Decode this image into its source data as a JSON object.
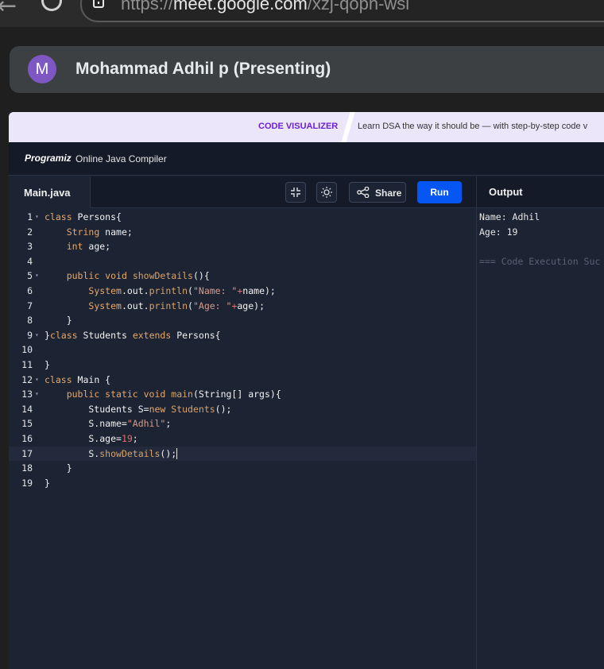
{
  "browser": {
    "url_scheme": "https://",
    "url_host": "meet.google.com",
    "url_path": "/xzj-qopn-wsi"
  },
  "meet": {
    "avatar_letter": "M",
    "presenter_label": "Mohammad Adhil p (Presenting)"
  },
  "promo": {
    "title": "CODE VISUALIZER",
    "text": "Learn DSA the way it should be — with step-by-step code v"
  },
  "nav": {
    "logo": "Programiz",
    "title": "Online Java Compiler"
  },
  "editor": {
    "tab_label": "Main.java",
    "share_label": "Share",
    "run_label": "Run",
    "active_line": 17,
    "lines": [
      {
        "n": "1",
        "fold": true,
        "tokens": [
          {
            "t": "kw",
            "v": "class"
          },
          {
            "t": "pl",
            "v": " Persons{"
          }
        ]
      },
      {
        "n": "2",
        "fold": false,
        "tokens": [
          {
            "t": "pl",
            "v": "    "
          },
          {
            "t": "kw",
            "v": "String"
          },
          {
            "t": "pl",
            "v": " name;"
          }
        ]
      },
      {
        "n": "3",
        "fold": false,
        "tokens": [
          {
            "t": "pl",
            "v": "    "
          },
          {
            "t": "kw",
            "v": "int"
          },
          {
            "t": "pl",
            "v": " age;"
          }
        ]
      },
      {
        "n": "4",
        "fold": false,
        "tokens": [
          {
            "t": "pl",
            "v": ""
          }
        ]
      },
      {
        "n": "5",
        "fold": true,
        "tokens": [
          {
            "t": "pl",
            "v": "    "
          },
          {
            "t": "kw",
            "v": "public void"
          },
          {
            "t": "pl",
            "v": " "
          },
          {
            "t": "fn",
            "v": "showDetails"
          },
          {
            "t": "pl",
            "v": "(){"
          }
        ]
      },
      {
        "n": "6",
        "fold": false,
        "tokens": [
          {
            "t": "pl",
            "v": "        "
          },
          {
            "t": "kw",
            "v": "System"
          },
          {
            "t": "pl",
            "v": ".out."
          },
          {
            "t": "fn",
            "v": "println"
          },
          {
            "t": "pl",
            "v": "("
          },
          {
            "t": "str",
            "v": "\"Name: \""
          },
          {
            "t": "num",
            "v": "+"
          },
          {
            "t": "pl",
            "v": "name);"
          }
        ]
      },
      {
        "n": "7",
        "fold": false,
        "tokens": [
          {
            "t": "pl",
            "v": "        "
          },
          {
            "t": "kw",
            "v": "System"
          },
          {
            "t": "pl",
            "v": ".out."
          },
          {
            "t": "fn",
            "v": "println"
          },
          {
            "t": "pl",
            "v": "("
          },
          {
            "t": "str",
            "v": "\"Age: \""
          },
          {
            "t": "num",
            "v": "+"
          },
          {
            "t": "pl",
            "v": "age);"
          }
        ]
      },
      {
        "n": "8",
        "fold": false,
        "tokens": [
          {
            "t": "pl",
            "v": "    }"
          }
        ]
      },
      {
        "n": "9",
        "fold": true,
        "tokens": [
          {
            "t": "pl",
            "v": "}"
          },
          {
            "t": "kw",
            "v": "class"
          },
          {
            "t": "pl",
            "v": " Students "
          },
          {
            "t": "kw",
            "v": "extends"
          },
          {
            "t": "pl",
            "v": " Persons{"
          }
        ]
      },
      {
        "n": "10",
        "fold": false,
        "tokens": [
          {
            "t": "pl",
            "v": ""
          }
        ]
      },
      {
        "n": "11",
        "fold": false,
        "tokens": [
          {
            "t": "pl",
            "v": "}"
          }
        ]
      },
      {
        "n": "12",
        "fold": true,
        "tokens": [
          {
            "t": "kw",
            "v": "class"
          },
          {
            "t": "pl",
            "v": " Main {"
          }
        ]
      },
      {
        "n": "13",
        "fold": true,
        "tokens": [
          {
            "t": "pl",
            "v": "    "
          },
          {
            "t": "kw",
            "v": "public static void"
          },
          {
            "t": "pl",
            "v": " "
          },
          {
            "t": "fn",
            "v": "main"
          },
          {
            "t": "pl",
            "v": "(String[] args){"
          }
        ]
      },
      {
        "n": "14",
        "fold": false,
        "tokens": [
          {
            "t": "pl",
            "v": "        Students S="
          },
          {
            "t": "kw",
            "v": "new"
          },
          {
            "t": "pl",
            "v": " "
          },
          {
            "t": "fn",
            "v": "Students"
          },
          {
            "t": "pl",
            "v": "();"
          }
        ]
      },
      {
        "n": "15",
        "fold": false,
        "tokens": [
          {
            "t": "pl",
            "v": "        S.name="
          },
          {
            "t": "str",
            "v": "\"Adhil\""
          },
          {
            "t": "pl",
            "v": ";"
          }
        ]
      },
      {
        "n": "16",
        "fold": false,
        "tokens": [
          {
            "t": "pl",
            "v": "        S.age="
          },
          {
            "t": "num",
            "v": "19"
          },
          {
            "t": "pl",
            "v": ";"
          }
        ]
      },
      {
        "n": "17",
        "fold": false,
        "tokens": [
          {
            "t": "pl",
            "v": "        S."
          },
          {
            "t": "fn",
            "v": "showDetails"
          },
          {
            "t": "pl",
            "v": "();"
          }
        ]
      },
      {
        "n": "18",
        "fold": false,
        "tokens": [
          {
            "t": "pl",
            "v": "    }"
          }
        ]
      },
      {
        "n": "19",
        "fold": false,
        "tokens": [
          {
            "t": "pl",
            "v": "}"
          }
        ]
      }
    ]
  },
  "output": {
    "title": "Output",
    "lines": [
      {
        "text": "Name: Adhil",
        "muted": false
      },
      {
        "text": "Age: 19",
        "muted": false
      },
      {
        "text": "",
        "muted": false
      },
      {
        "text": "=== Code Execution Suc",
        "muted": true
      }
    ]
  },
  "colors": {
    "run_button": "#0556f3",
    "promo_accent": "#6b21d8",
    "avatar": "#7e57c2",
    "editor_bg": "#1c2333"
  },
  "icons": {
    "exit_fullscreen": "collapse-icon",
    "theme": "sun-icon",
    "share": "share-nodes-icon"
  }
}
